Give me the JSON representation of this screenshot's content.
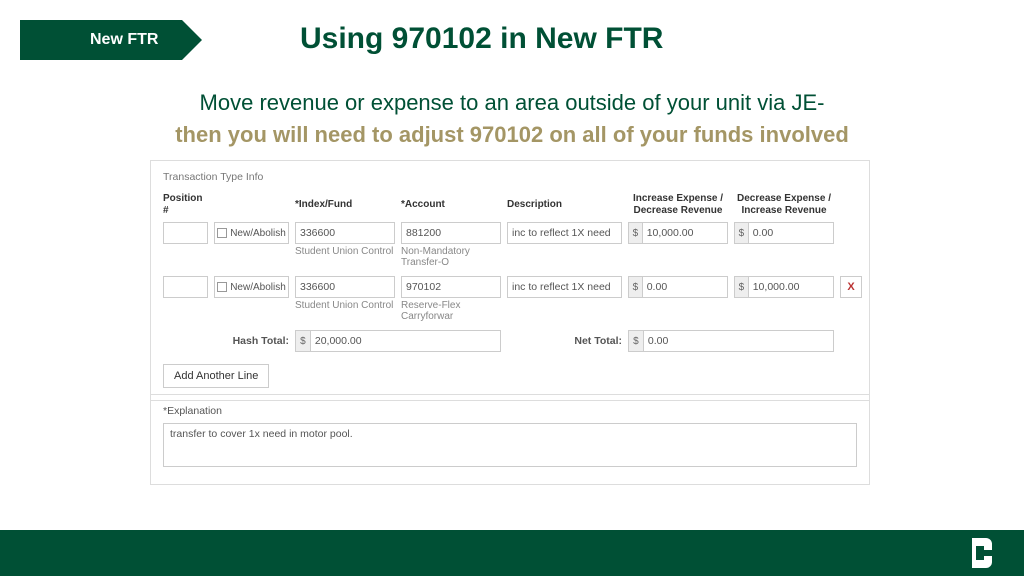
{
  "tag": "New FTR",
  "title": "Using 970102 in New FTR",
  "intro1": "Move revenue or expense to an area outside of your unit via JE-",
  "intro2": "then you will need to adjust 970102 on all of your funds involved",
  "panel_title": "Transaction Type Info",
  "headers": {
    "position": "Position #",
    "index": "*Index/Fund",
    "account": "*Account",
    "description": "Description",
    "inc": "Increase Expense / Decrease Revenue",
    "dec": "Decrease Expense / Increase Revenue"
  },
  "rows": [
    {
      "newabolish": "New/Abolish",
      "index": "336600",
      "index_sub": "Student Union Control",
      "account": "881200",
      "account_sub": "Non-Mandatory Transfer-O",
      "description": "inc to reflect 1X need",
      "inc": "10,000.00",
      "dec": "0.00",
      "deletable": false
    },
    {
      "newabolish": "New/Abolish",
      "index": "336600",
      "index_sub": "Student Union Control",
      "account": "970102",
      "account_sub": "Reserve-Flex Carryforwar",
      "description": "inc to reflect 1X need",
      "inc": "0.00",
      "dec": "10,000.00",
      "deletable": true
    }
  ],
  "currency": "$",
  "hash_label": "Hash Total:",
  "hash_value": "20,000.00",
  "net_label": "Net Total:",
  "net_value": "0.00",
  "add_line": "Add Another Line",
  "expl_label": "*Explanation",
  "expl_value": "transfer to cover 1x need in motor pool.",
  "delete_label": "X"
}
